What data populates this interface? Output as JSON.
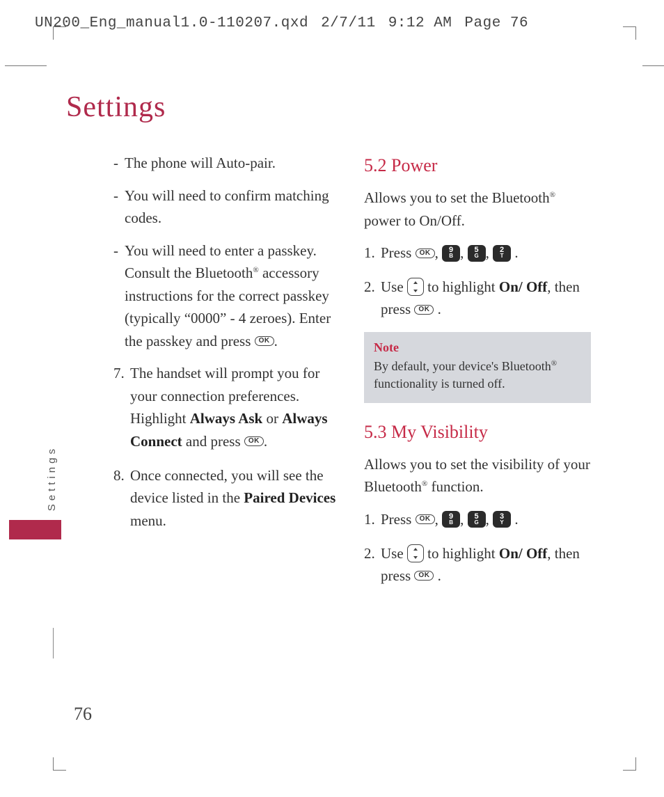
{
  "header": {
    "filename": "UN200_Eng_manual1.0-110207.qxd",
    "date": "2/7/11",
    "time": "9:12 AM",
    "page_label": "Page 76"
  },
  "title": "Settings",
  "side_tab_label": "Settings",
  "page_number": "76",
  "left": {
    "b1": "The phone will Auto-pair.",
    "b2": "You will need to confirm matching codes.",
    "b3_a": "You will need to enter a passkey. Consult the Bluetooth",
    "b3_b": " accessory instructions for the correct passkey (typically “0000” - 4 zeroes). Enter the passkey and press ",
    "s7_num": "7.",
    "s7_a": "The handset will prompt you for your connection preferences. Highlight ",
    "s7_bold1": "Always Ask",
    "s7_mid": " or ",
    "s7_bold2": "Always Connect",
    "s7_b": " and press ",
    "s8_num": "8.",
    "s8_a": "Once connected, you will see the device listed in the ",
    "s8_bold": "Paired Devices",
    "s8_b": " menu."
  },
  "right": {
    "h52": "5.2 Power",
    "p52_a": "Allows you to set the Bluetooth",
    "p52_b": " power to On/Off.",
    "s1_num": "1.",
    "s1_press": "Press ",
    "s2_num": "2.",
    "s2_a": "Use ",
    "s2_b": " to highlight ",
    "s2_bold": "On/ Off",
    "s2_c": ", then press ",
    "note_title": "Note",
    "note_a": "By default, your device's Bluetooth",
    "note_b": " functionality is turned off.",
    "h53": "5.3 My Visibility",
    "p53_a": "Allows you to set the visibility of your Bluetooth",
    "p53_b": " function.",
    "s31_num": "1.",
    "s31_press": "Press ",
    "s32_num": "2.",
    "s32_a": "Use ",
    "s32_b": " to highlight ",
    "s32_bold": "On/ Off",
    "s32_c": ", then press "
  },
  "keys": {
    "ok": "OK",
    "k9n": "9",
    "k9l": "B",
    "k5n": "5",
    "k5l": "G",
    "k2n": "2",
    "k2l": "T",
    "k3n": "3",
    "k3l": "Y"
  },
  "glyphs": {
    "reg": "®",
    "comma": ", ",
    "period": " ."
  }
}
